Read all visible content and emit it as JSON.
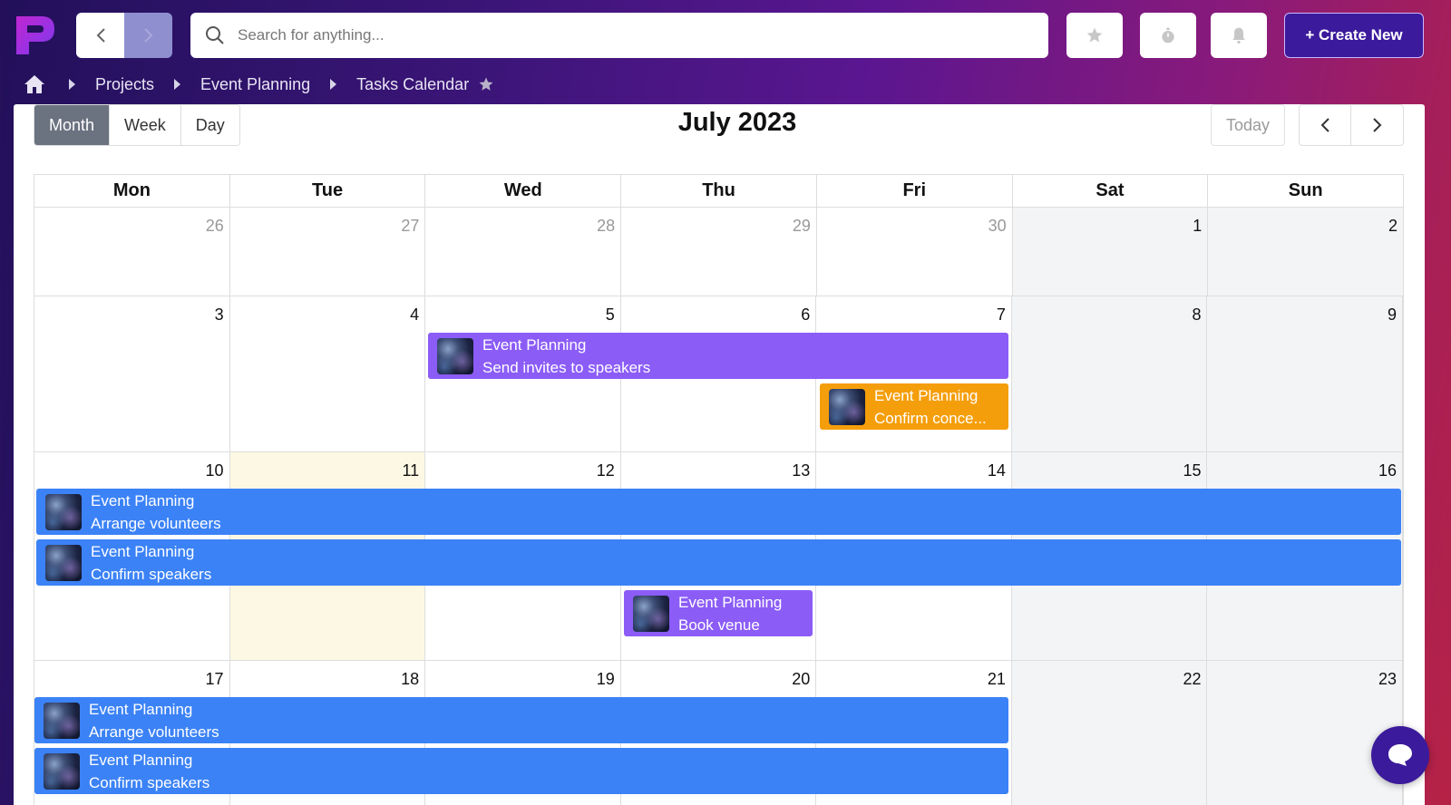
{
  "topbar": {
    "search_placeholder": "Search for anything...",
    "create_label": "+ Create New",
    "icons": [
      "logo-icon",
      "back-arrow-icon",
      "forward-arrow-icon",
      "search-icon",
      "star-icon",
      "timer-icon",
      "bell-icon"
    ]
  },
  "breadcrumb": {
    "items": [
      "Projects",
      "Event Planning",
      "Tasks Calendar"
    ]
  },
  "calendar": {
    "views": [
      "Month",
      "Week",
      "Day"
    ],
    "active_view": "Month",
    "title": "July 2023",
    "today_label": "Today",
    "weekdays": [
      "Mon",
      "Tue",
      "Wed",
      "Thu",
      "Fri",
      "Sat",
      "Sun"
    ],
    "weeks": [
      [
        "26",
        "27",
        "28",
        "29",
        "30",
        "1",
        "2"
      ],
      [
        "3",
        "4",
        "5",
        "6",
        "7",
        "8",
        "9"
      ],
      [
        "10",
        "11",
        "12",
        "13",
        "14",
        "15",
        "16"
      ],
      [
        "17",
        "18",
        "19",
        "20",
        "21",
        "22",
        "23"
      ]
    ],
    "events": [
      {
        "project": "Event Planning",
        "task": "Send invites to speakers",
        "color": "#8b5cf6"
      },
      {
        "project": "Event Planning",
        "task": "Confirm conce...",
        "color": "#f59e0b"
      },
      {
        "project": "Event Planning",
        "task": "Arrange volunteers",
        "color": "#3b82f6"
      },
      {
        "project": "Event Planning",
        "task": "Confirm speakers",
        "color": "#3b82f6"
      },
      {
        "project": "Event Planning",
        "task": "Book venue",
        "color": "#8b5cf6"
      },
      {
        "project": "Event Planning",
        "task": "Arrange volunteers",
        "color": "#3b82f6"
      },
      {
        "project": "Event Planning",
        "task": "Confirm speakers",
        "color": "#3b82f6"
      }
    ]
  },
  "colors": {
    "accent": "#3b1a9c",
    "today_highlight": "#fdf8e3",
    "weekend": "#f3f4f6"
  }
}
